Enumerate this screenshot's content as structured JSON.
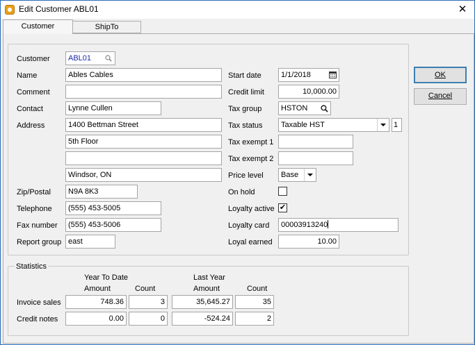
{
  "window": {
    "title": "Edit Customer ABL01",
    "close_glyph": "✕"
  },
  "tabs": [
    {
      "label": "Customer"
    },
    {
      "label": "ShipTo"
    }
  ],
  "customer": {
    "customer_label": "Customer",
    "customer_value": "ABL01",
    "name_label": "Name",
    "name_value": "Ables Cables",
    "comment_label": "Comment",
    "comment_value": "",
    "contact_label": "Contact",
    "contact_value": "Lynne Cullen",
    "address_label": "Address",
    "address_1": "1400 Bettman Street",
    "address_2": "5th Floor",
    "address_3": "",
    "address_4": "Windsor, ON",
    "zip_label": "Zip/Postal",
    "zip_value": "N9A 8K3",
    "telephone_label": "Telephone",
    "telephone_value": "(555) 453-5005",
    "fax_label": "Fax number",
    "fax_value": "(555) 453-5006",
    "report_group_label": "Report group",
    "report_group_value": "east"
  },
  "terms": {
    "start_date_label": "Start date",
    "start_date_value": "1/1/2018",
    "credit_limit_label": "Credit limit",
    "credit_limit_value": "10,000.00",
    "tax_group_label": "Tax group",
    "tax_group_value": "HSTON",
    "tax_status_label": "Tax status",
    "tax_status_value": "Taxable HST",
    "tax_status_code": "1",
    "tax_exempt1_label": "Tax exempt 1",
    "tax_exempt1_value": "",
    "tax_exempt2_label": "Tax exempt 2",
    "tax_exempt2_value": "",
    "price_level_label": "Price level",
    "price_level_value": "Base",
    "on_hold_label": "On hold",
    "on_hold_checked": false,
    "loyalty_active_label": "Loyalty active",
    "loyalty_active_checked": true,
    "check_glyph": "✔",
    "loyalty_card_label": "Loyalty card",
    "loyalty_card_value": "00003913240",
    "loyal_earned_label": "Loyal earned",
    "loyal_earned_value": "10.00"
  },
  "buttons": {
    "ok_label": "OK",
    "cancel_label": "Cancel"
  },
  "statistics": {
    "title": "Statistics",
    "ytd_header_1": "Year To Date",
    "ytd_header_2": "Amount",
    "ly_header_1": "Last Year",
    "ly_header_2": "Amount",
    "count_header": "Count",
    "rows": [
      {
        "label": "Invoice sales",
        "ytd_amount": "748.36",
        "ytd_count": "3",
        "ly_amount": "35,645.27",
        "ly_count": "35"
      },
      {
        "label": "Credit notes",
        "ytd_amount": "0.00",
        "ytd_count": "0",
        "ly_amount": "-524.24",
        "ly_count": "2"
      }
    ]
  },
  "icons": {
    "app": "app-icon",
    "lookup": "magnifier-icon",
    "calendar": "calendar-icon",
    "dropdown": "chevron-down-icon",
    "close": "close-icon"
  }
}
